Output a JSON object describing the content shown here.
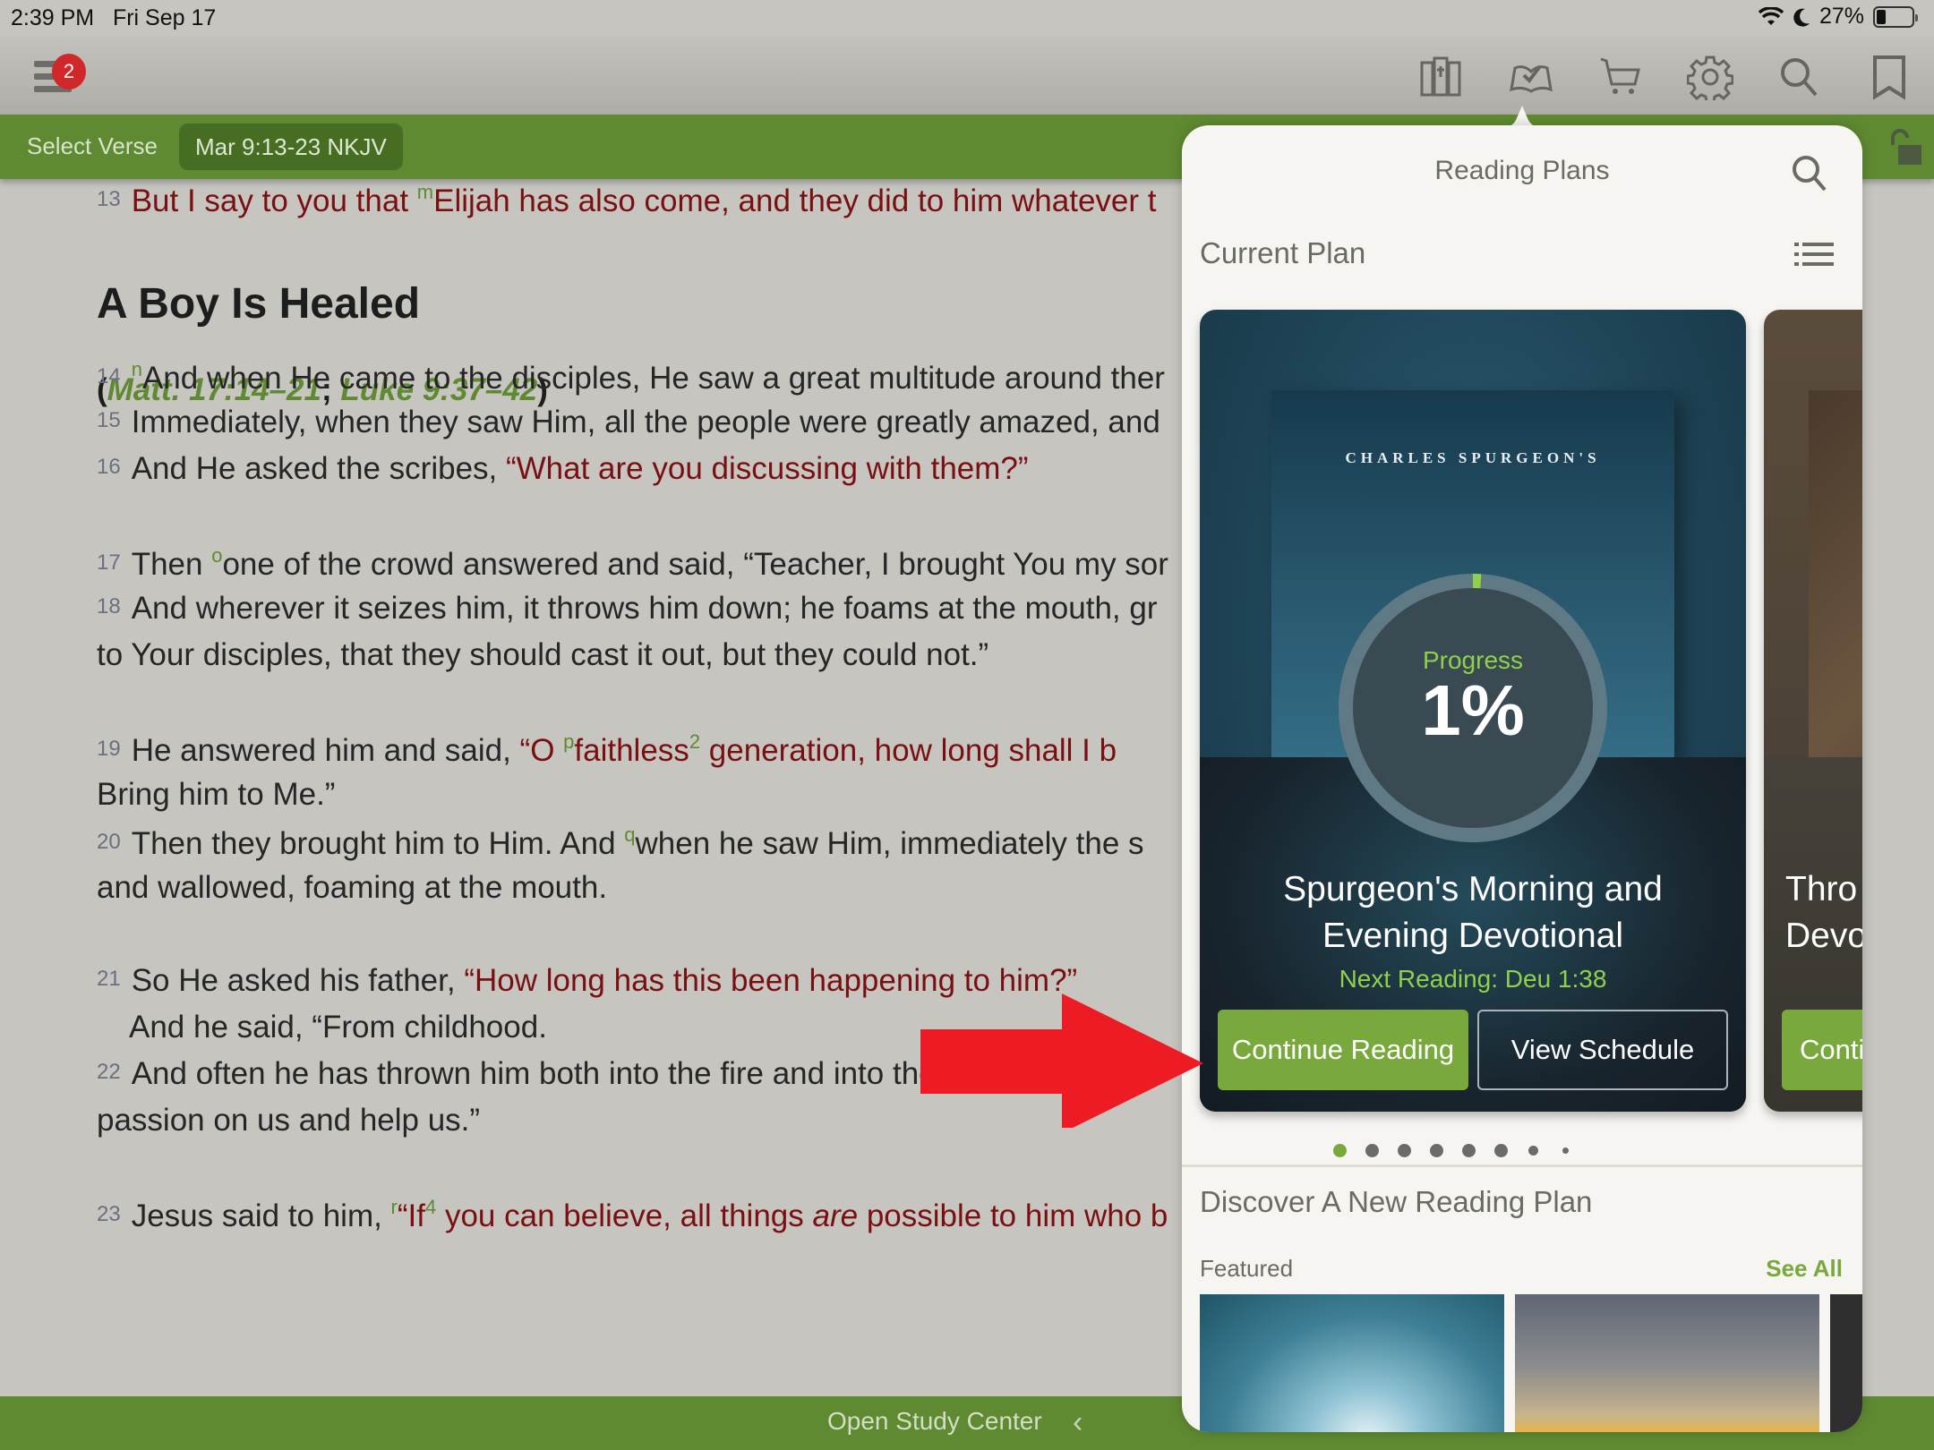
{
  "status_bar": {
    "time": "2:39 PM",
    "date": "Fri Sep 17",
    "battery": "27%",
    "battery_level": 0.27,
    "icons": [
      "wifi-icon",
      "moon-icon",
      "battery-icon"
    ]
  },
  "toolbar": {
    "menu_badge": "2",
    "icons": [
      "library-icon",
      "reading-plans-icon",
      "cart-icon",
      "settings-icon",
      "search-icon",
      "bookmark-icon"
    ]
  },
  "verse_bar": {
    "select_verse": "Select Verse",
    "reference": "Mar 9:13-23 NKJV"
  },
  "scripture": {
    "v13": {
      "num": "13",
      "text_red": "But I say to you that ",
      "xref": "m",
      "text_red2": "Elijah has also come, and they did to him whatever t"
    },
    "heading": "A Boy Is Healed",
    "parallel": {
      "open": "(",
      "ref1": "Matt. 17:14–21",
      "sep": "; ",
      "ref2": "Luke 9:37–42",
      "close": ")"
    },
    "v14": {
      "num": "14",
      "xref": "n",
      "text": "And when He came to the disciples, He saw a great multitude around ther"
    },
    "v15": {
      "num": "15",
      "text": "Immediately, when they saw Him, all the people were greatly amazed, and"
    },
    "v16": {
      "num": "16",
      "text": "And He asked the scribes, ",
      "text_red": "“What are you discussing with them?”"
    },
    "v17": {
      "num": "17",
      "text_a": "Then ",
      "xref": "o",
      "text_b": "one of the crowd answered and said, “Teacher, I brought You my sor"
    },
    "v18": {
      "num": "18",
      "text": "And wherever it seizes him, it throws him down; he foams at the mouth, gr",
      "cont": "to Your disciples, that they should cast it out, but they could not.”"
    },
    "v19": {
      "num": "19",
      "text": "He answered him and said, ",
      "red_a": "“O ",
      "xref": "p",
      "red_b": "faithless",
      "fn": "2",
      "red_c": " generation, how long shall I b",
      "cont": "Bring him to Me.”"
    },
    "v20": {
      "num": "20",
      "text_a": "Then they brought him to Him. And ",
      "xref": "q",
      "text_b": "when he saw Him, immediately the s",
      "cont": "and wallowed, foaming at the mouth."
    },
    "v21": {
      "num": "21",
      "text": "So He asked his father, ",
      "text_red": "“How long has this been happening to him?”",
      "cont": "And he said, “From childhood."
    },
    "v22": {
      "num": "22",
      "text": "And often he has thrown him both into the fire and into the water to destr",
      "cont": "passion on us and help us.”"
    },
    "v23": {
      "num": "23",
      "text": "Jesus said to him, ",
      "xref": "r",
      "red_a": "“If",
      "fn": "4",
      "red_b": " you can believe, all things ",
      "red_italic": "are",
      "red_c": " possible to him who b"
    }
  },
  "bottom_bar": {
    "study_center": "Open Study Center",
    "chevron": "‹"
  },
  "reading_plans": {
    "title": "Reading Plans",
    "current_plan_label": "Current Plan",
    "current_plan": {
      "cover_text": "CHARLES SPURGEON'S",
      "progress_label": "Progress",
      "progress_value": "1%",
      "progress_fraction": 0.01,
      "title": "Spurgeon's Morning and Evening Devotional",
      "title_line1": "Spurgeon's Morning and",
      "title_line2": "Evening Devotional",
      "next_reading": "Next Reading: Deu 1:38",
      "continue_label": "Continue Reading",
      "schedule_label": "View Schedule"
    },
    "next_plan": {
      "title_line1": "Thro",
      "title_line2": "Devo",
      "continue_label": "Conti"
    },
    "page_dots": {
      "count": 8,
      "active": 0
    },
    "discover_label": "Discover A New Reading Plan",
    "featured_label": "Featured",
    "see_all_label": "See All"
  },
  "colors": {
    "accent_green": "#79a83c",
    "bar_green": "#5f8a31",
    "words_of_christ": "#7a0f12",
    "progress_green": "#8fd14a",
    "annotation_arrow": "#ed1c24"
  }
}
